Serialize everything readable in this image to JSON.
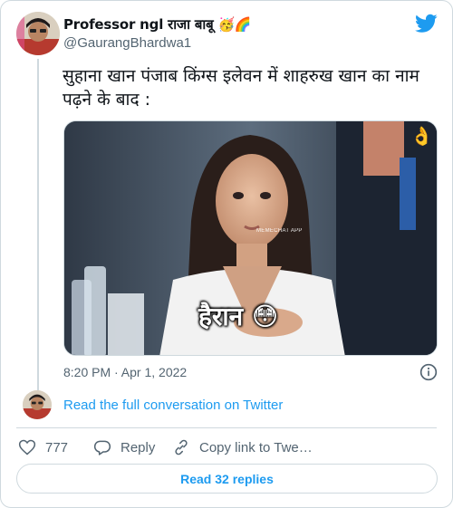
{
  "author": {
    "display_name": "Professor ngl राजा बाबू 🥳🌈",
    "handle": "@GaurangBhardwa1"
  },
  "tweet": {
    "text": "सुहाना खान पंजाब किंग्स इलेवन में शाहरुख खान का नाम पढ़ने के बाद :",
    "media": {
      "caption": "हैरान 😳",
      "watermark": "MEMECHAT APP",
      "corner_emoji": "👌"
    },
    "timestamp": "8:20 PM · Apr 1, 2022"
  },
  "conversation_link": "Read the full conversation on Twitter",
  "actions": {
    "like_count": "777",
    "reply_label": "Reply",
    "copy_label": "Copy link to Twe…"
  },
  "replies_button": "Read 32 replies",
  "colors": {
    "accent": "#1d9bf0",
    "secondary_text": "#536471",
    "border": "#cfd9de"
  },
  "icons": [
    "twitter-bird-icon",
    "info-icon",
    "heart-icon",
    "reply-bubble-icon",
    "link-icon"
  ]
}
